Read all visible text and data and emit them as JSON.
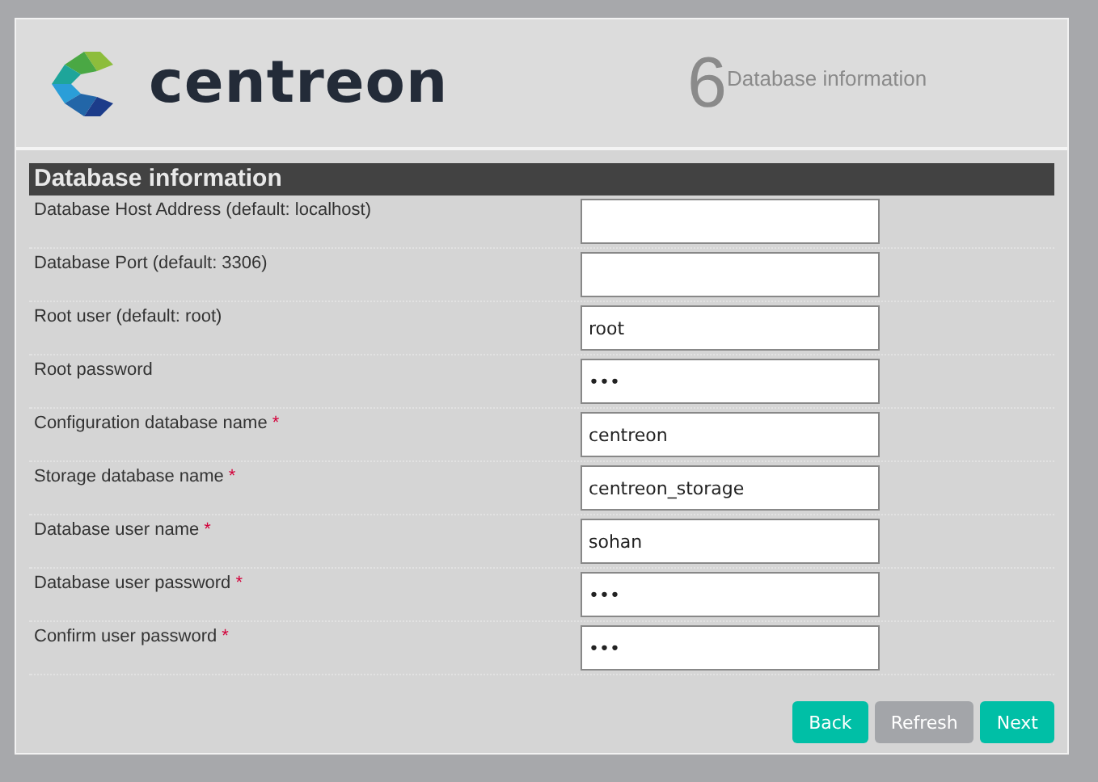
{
  "header": {
    "logo_text": "centreon",
    "step_number": "6",
    "step_title": "Database information"
  },
  "section": {
    "title": "Database information"
  },
  "fields": [
    {
      "label": "Database Host Address (default: localhost)"
    },
    {
      "label": "Database Port (default: 3306)"
    },
    {
      "label": "Root user (default: root)",
      "value": "root"
    },
    {
      "label": "Root password",
      "value": "•••"
    },
    {
      "label": "Configuration database name",
      "required_mark": "*",
      "value": "centreon"
    },
    {
      "label": "Storage database name",
      "required_mark": "*",
      "value": "centreon_storage"
    },
    {
      "label": "Database user name",
      "required_mark": "*",
      "value": "sohan"
    },
    {
      "label": "Database user password",
      "required_mark": "*",
      "value": "•••"
    },
    {
      "label": "Confirm user password",
      "required_mark": "*",
      "value": "•••"
    }
  ],
  "buttons": [
    {
      "label": "Back",
      "disabled": false
    },
    {
      "label": "Refresh",
      "disabled": true
    },
    {
      "label": "Next",
      "disabled": false
    }
  ]
}
